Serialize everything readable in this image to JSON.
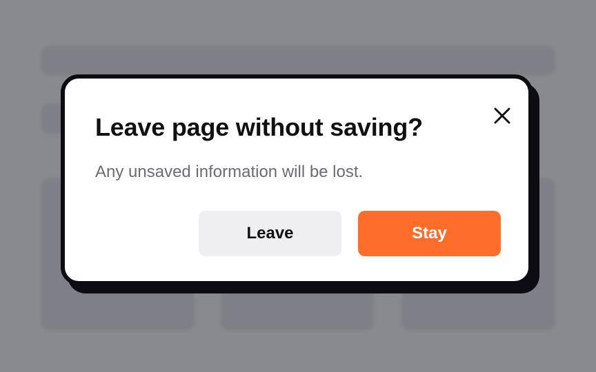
{
  "dialog": {
    "title": "Leave page without saving?",
    "message": "Any unsaved information will be lost.",
    "leave_label": "Leave",
    "stay_label": "Stay",
    "close_icon": "close-icon"
  },
  "colors": {
    "accent": "#ff6d2a",
    "secondary_button": "#efeff2",
    "overlay": "#898990",
    "modal_border": "#0c0c12"
  }
}
